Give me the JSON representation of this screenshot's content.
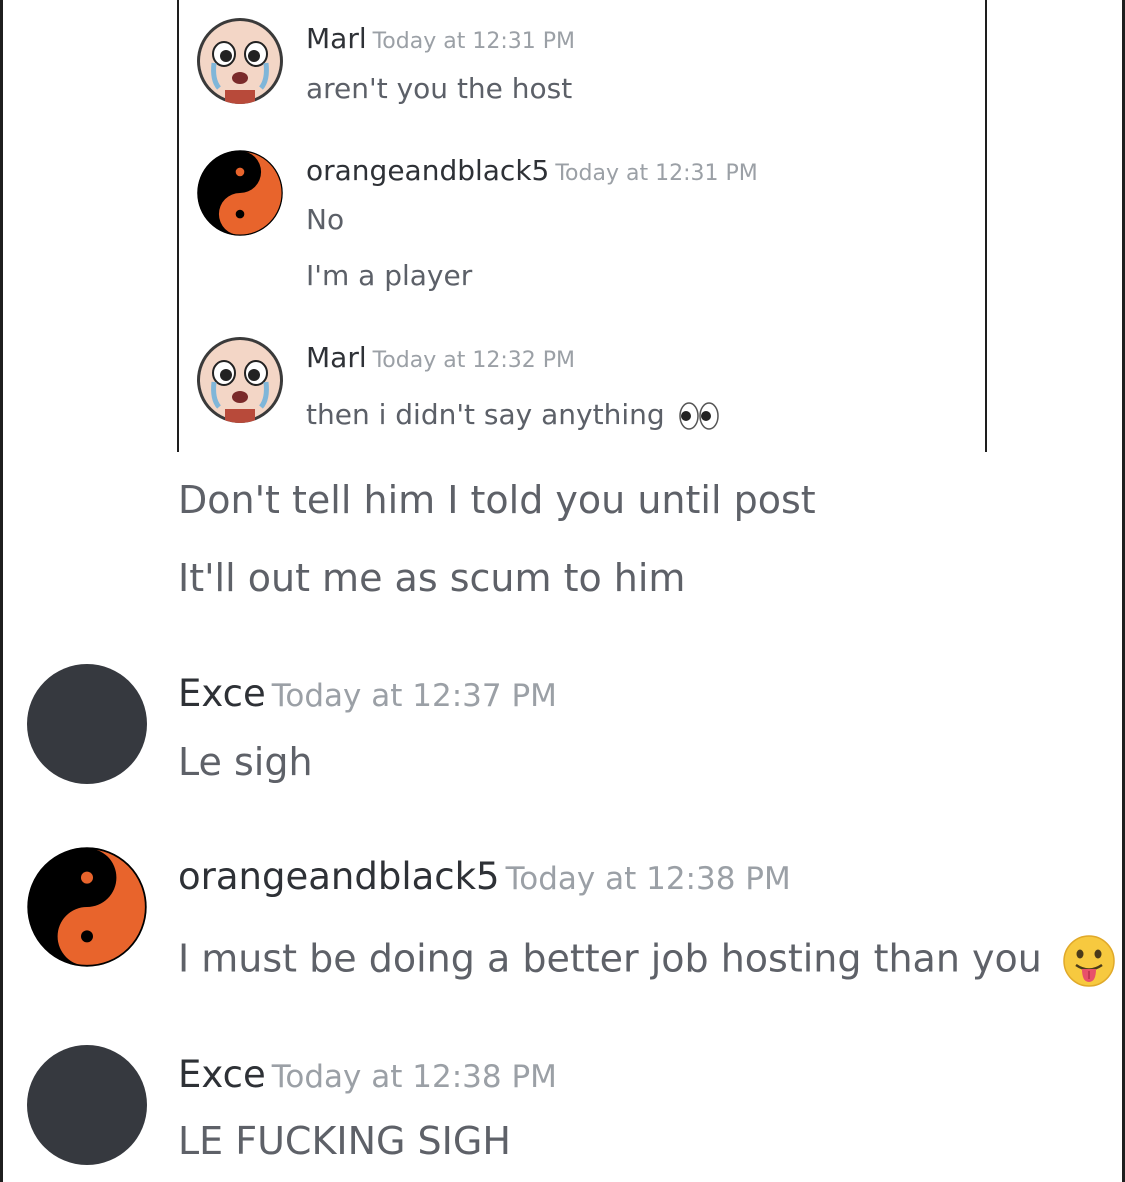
{
  "quoted": {
    "messages": [
      {
        "author": "Marl",
        "timestamp": "Today at 12:31 PM",
        "avatar": "crying-baby-avatar",
        "lines": [
          "aren't you the host"
        ]
      },
      {
        "author": "orangeandblack5",
        "timestamp": "Today at 12:31 PM",
        "avatar": "yin-yang-orange-avatar",
        "lines": [
          "No",
          "I'm a player"
        ]
      },
      {
        "author": "Marl",
        "timestamp": "Today at 12:32 PM",
        "avatar": "crying-baby-avatar",
        "lines": [
          "then i didn't say anything"
        ],
        "emoji": "eyes-emoji"
      }
    ]
  },
  "continuation": {
    "lines": [
      "Don't tell him I told you until post",
      "It'll out me as scum to him"
    ]
  },
  "messages": [
    {
      "author": "Exce",
      "timestamp": "Today at 12:37 PM",
      "avatar": "dark-circle-avatar",
      "lines": [
        "Le sigh"
      ]
    },
    {
      "author": "orangeandblack5",
      "timestamp": "Today at 12:38 PM",
      "avatar": "yin-yang-orange-avatar",
      "lines": [
        "I must be doing a better job hosting than you"
      ],
      "emoji": "tongue-out-emoji"
    },
    {
      "author": "Exce",
      "timestamp": "Today at 12:38 PM",
      "avatar": "dark-circle-avatar",
      "lines": [
        "LE FUCKING SIGH"
      ]
    }
  ],
  "colors": {
    "username": "#2e3136",
    "timestamp": "#9ba0a6",
    "message_text": "#5e6168",
    "dark_avatar": "#36393f",
    "yin_yang_orange": "#e8642c"
  }
}
